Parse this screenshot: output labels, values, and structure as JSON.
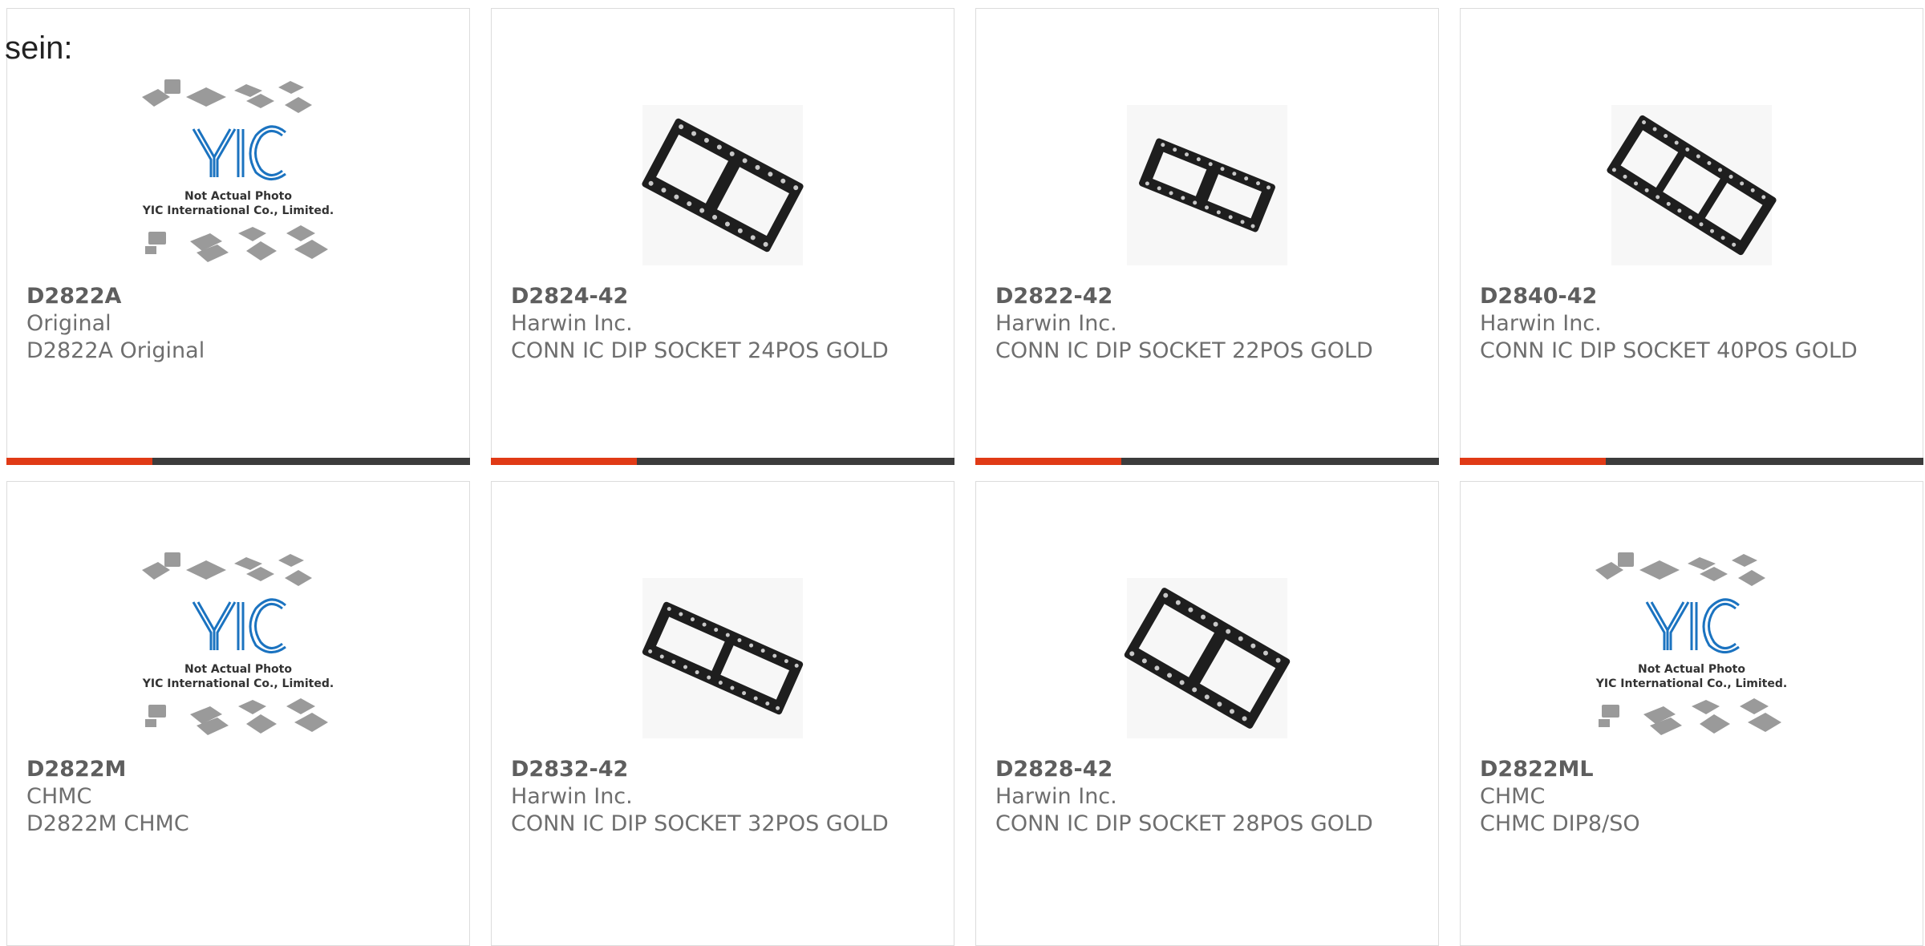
{
  "page": {
    "heading": "sein:"
  },
  "colors": {
    "accent": "#e03a16",
    "bar": "#3c3c3c",
    "logo_blue": "#1b73c0"
  },
  "placeholder_image": {
    "icon": "yic-logo-icon",
    "line1": "Not Actual Photo",
    "line2": "YIC International Co., Limited."
  },
  "products": [
    {
      "part": "D2822A",
      "maker": "Original",
      "desc": "D2822A Original",
      "image": "placeholder"
    },
    {
      "part": "D2824-42",
      "maker": "Harwin Inc.",
      "desc": "CONN IC DIP SOCKET 24POS GOLD",
      "image": "dip-socket-icon"
    },
    {
      "part": "D2822-42",
      "maker": "Harwin Inc.",
      "desc": "CONN IC DIP SOCKET 22POS GOLD",
      "image": "dip-socket-icon"
    },
    {
      "part": "D2840-42",
      "maker": "Harwin Inc.",
      "desc": "CONN IC DIP SOCKET 40POS GOLD",
      "image": "dip-socket-icon"
    },
    {
      "part": "D2822M",
      "maker": "CHMC",
      "desc": "D2822M CHMC",
      "image": "placeholder"
    },
    {
      "part": "D2832-42",
      "maker": "Harwin Inc.",
      "desc": "CONN IC DIP SOCKET 32POS GOLD",
      "image": "dip-socket-icon"
    },
    {
      "part": "D2828-42",
      "maker": "Harwin Inc.",
      "desc": "CONN IC DIP SOCKET 28POS GOLD",
      "image": "dip-socket-icon"
    },
    {
      "part": "D2822ML",
      "maker": "CHMC",
      "desc": "CHMC DIP8/SO",
      "image": "placeholder"
    }
  ]
}
